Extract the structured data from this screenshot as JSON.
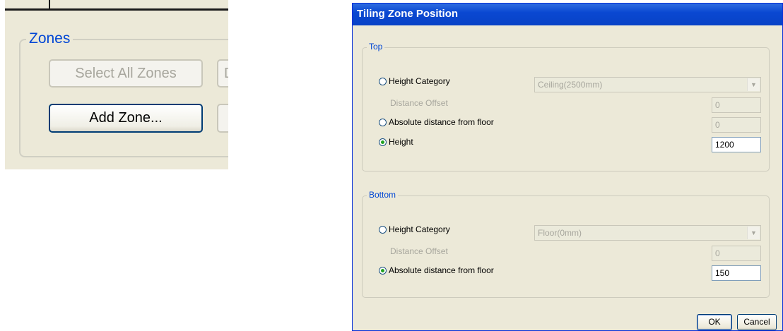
{
  "zoom": {
    "group_label": "Zones",
    "select_all_zones": "Select All Zones",
    "add_zone": "Add Zone...",
    "clipped_button_fragment": "D"
  },
  "dialog": {
    "title": "Tiling Zone Position",
    "top": {
      "group_label": "Top",
      "height_category_label": "Height Category",
      "height_category_value": "Ceiling(2500mm)",
      "distance_offset_label": "Distance Offset",
      "distance_offset_value": "0",
      "absolute_distance_label": "Absolute distance from floor",
      "absolute_distance_value": "0",
      "height_label": "Height",
      "height_value": "1200",
      "selected_option": "Height"
    },
    "bottom": {
      "group_label": "Bottom",
      "height_category_label": "Height Category",
      "height_category_value": "Floor(0mm)",
      "distance_offset_label": "Distance Offset",
      "distance_offset_value": "0",
      "absolute_distance_label": "Absolute distance from floor",
      "absolute_distance_value": "150",
      "selected_option": "Absolute distance from floor"
    },
    "ok_label": "OK",
    "cancel_label": "Cancel"
  },
  "colors": {
    "dialog_face": "#ece9d8",
    "titlebar": "#0a48d2",
    "group_label": "#0046d5",
    "radio_selected": "#21a121"
  }
}
